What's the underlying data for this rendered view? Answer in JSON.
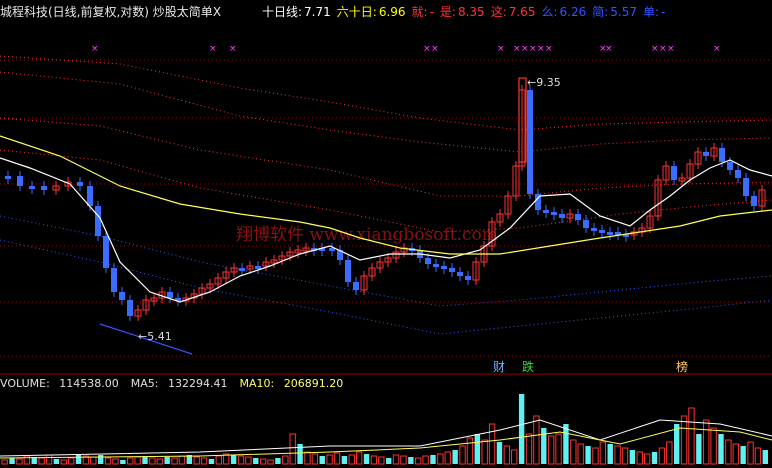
{
  "header": {
    "title": "城程科技(日线,前复权,对数) 炒股太简单",
    "close_glyph": "X",
    "indicators": [
      {
        "label": "十日线:",
        "value": "7.71",
        "color": "#ffffff"
      },
      {
        "label": "六十日:",
        "value": "6.96",
        "color": "#ffff00"
      },
      {
        "label": "就:",
        "value": "-",
        "color": "#ff3333"
      },
      {
        "label": "是:",
        "value": "8.35",
        "color": "#ff3333"
      },
      {
        "label": "这:",
        "value": "7.65",
        "color": "#ff3333"
      },
      {
        "label": "么:",
        "value": "6.26",
        "color": "#3355ff"
      },
      {
        "label": "简:",
        "value": "5.57",
        "color": "#3355ff"
      },
      {
        "label": "单:",
        "value": "-",
        "color": "#3355ff"
      }
    ]
  },
  "annotations": {
    "high": "9.35",
    "low": "5.41"
  },
  "event_tags": [
    {
      "text": "财",
      "color": "#6fb6ff"
    },
    {
      "text": "跌",
      "color": "#33dd33"
    },
    {
      "text": "榜",
      "color": "#ffcc66"
    }
  ],
  "watermark": "翔博软件 www.xiangbosoft.com",
  "volume": {
    "label": "VOLUME:",
    "value": "114538.00",
    "ma5_label": "MA5:",
    "ma5_value": "132294.41",
    "ma10_label": "MA10:",
    "ma10_value": "206891.20"
  },
  "colors": {
    "up": "#ff3232",
    "down": "#3a6dff",
    "down_volume": "#5ff0f0",
    "ma10": "#ffffff",
    "ma60": "#ffff55",
    "band": "#ff3333",
    "lower_band": "#3355ff",
    "marker": "#ff44ff",
    "grid": "#a00000"
  }
}
